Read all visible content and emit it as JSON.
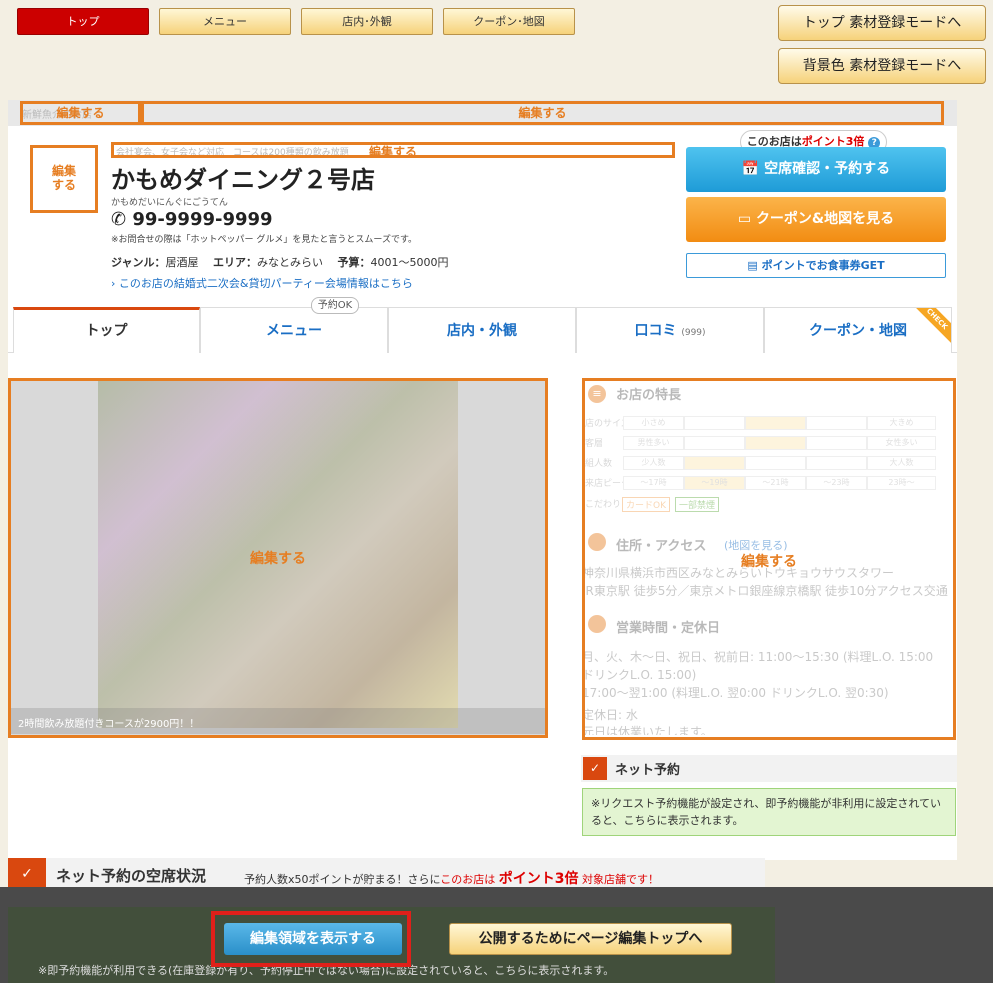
{
  "top_nav": {
    "top": "トップ",
    "menu": "メニュー",
    "interior": "店内･外観",
    "coupon": "クーポン･地図"
  },
  "mode_buttons": {
    "material": "トップ 素材登録モードへ",
    "bgcolor": "背景色 素材登録モードへ"
  },
  "edit_label": "編集する",
  "header": {
    "banner_text": "新鮮魚介のお店",
    "catch": "会社宴会、女子会など対応　コースは200種類の飲み放題",
    "shop_name": "かもめダイニング２号店",
    "shop_kana": "かもめだいにんぐにごうてん",
    "phone": "99-9999-9999",
    "phone_note": "※お問合せの際は「ホットペッパー グルメ」を見たと言うとスムーズです。",
    "genre_label": "ジャンル：",
    "genre": "居酒屋",
    "area_label": "エリア：",
    "area": "みなとみらい",
    "budget_label": "予算：",
    "budget": "4001～5000円",
    "wedding_link": "このお店の結婚式二次会&貸切パーティー会場情報はこちら"
  },
  "points": {
    "prefix": "このお店は",
    "highlight": "ポイント3倍",
    "help": "?"
  },
  "buttons": {
    "reserve": "空席確認・予約する",
    "coupon": "クーポン&地図を見る",
    "meal_ticket": "ポイントでお食事券GET"
  },
  "tabs": {
    "top": "トップ",
    "menu": "メニュー",
    "menu_badge": "予約OK",
    "interior": "店内・外観",
    "reviews": "口コミ",
    "reviews_count": "(999)",
    "coupon": "クーポン・地図",
    "check": "CHECK"
  },
  "photo": {
    "caption": "2時間飲み放題付きコースが2900円！！"
  },
  "features": {
    "title": "お店の特長",
    "rows": [
      {
        "label": "店のサイズ",
        "cells": [
          "小さめ",
          "",
          "",
          "",
          "大きめ"
        ]
      },
      {
        "label": "客層",
        "cells": [
          "男性多い",
          "",
          "",
          "",
          "女性多い"
        ]
      },
      {
        "label": "組人数",
        "cells": [
          "少人数",
          "",
          "",
          "",
          "大人数"
        ]
      },
      {
        "label": "来店ピーク",
        "cells": [
          "～17時",
          "～19時",
          "～21時",
          "～23時",
          "23時～"
        ]
      }
    ],
    "tags_label": "こだわり",
    "tag1": "カードOK",
    "tag2": "一部禁煙",
    "access_title": "住所・アクセス",
    "map_link": "(地図を見る)",
    "address": "神奈川県横浜市西区みなとみらいトウキョウサウスタワー",
    "access": "JR東京駅 徒歩5分／東京メトロ銀座線京橋駅 徒歩10分アクセス交通",
    "hours_title": "営業時間・定休日",
    "hours1": "月、火、木～日、祝日、祝前日: 11:00～15:30 (料理L.O. 15:00",
    "hours2": "ドリンクL.O. 15:00)",
    "hours3": "17:00～翌1:00 (料理L.O. 翌0:00 ドリンクL.O. 翌0:30)",
    "closed1": "定休日: 水",
    "closed2": "元日は休業いたします。"
  },
  "net_reserve": {
    "title": "ネット予約",
    "notice": "※リクエスト予約機能が設定され、即予約機能が非利用に設定されていると、こちらに表示されます。"
  },
  "availability": {
    "title": "ネット予約の空席状況",
    "text1": "予約人数x50ポイントが貯まる！さらに",
    "text2": "このお店は",
    "text3": "ポイント3倍",
    "text4": "対象店舗です！",
    "notice": "※即予約機能が利用できる(在庫登録が有り、予約停止中ではない場合)に設定されていると、こちらに表示されます。"
  },
  "bottom_bar": {
    "show_edit": "編集領域を表示する",
    "publish": "公開するためにページ編集トップへ"
  }
}
